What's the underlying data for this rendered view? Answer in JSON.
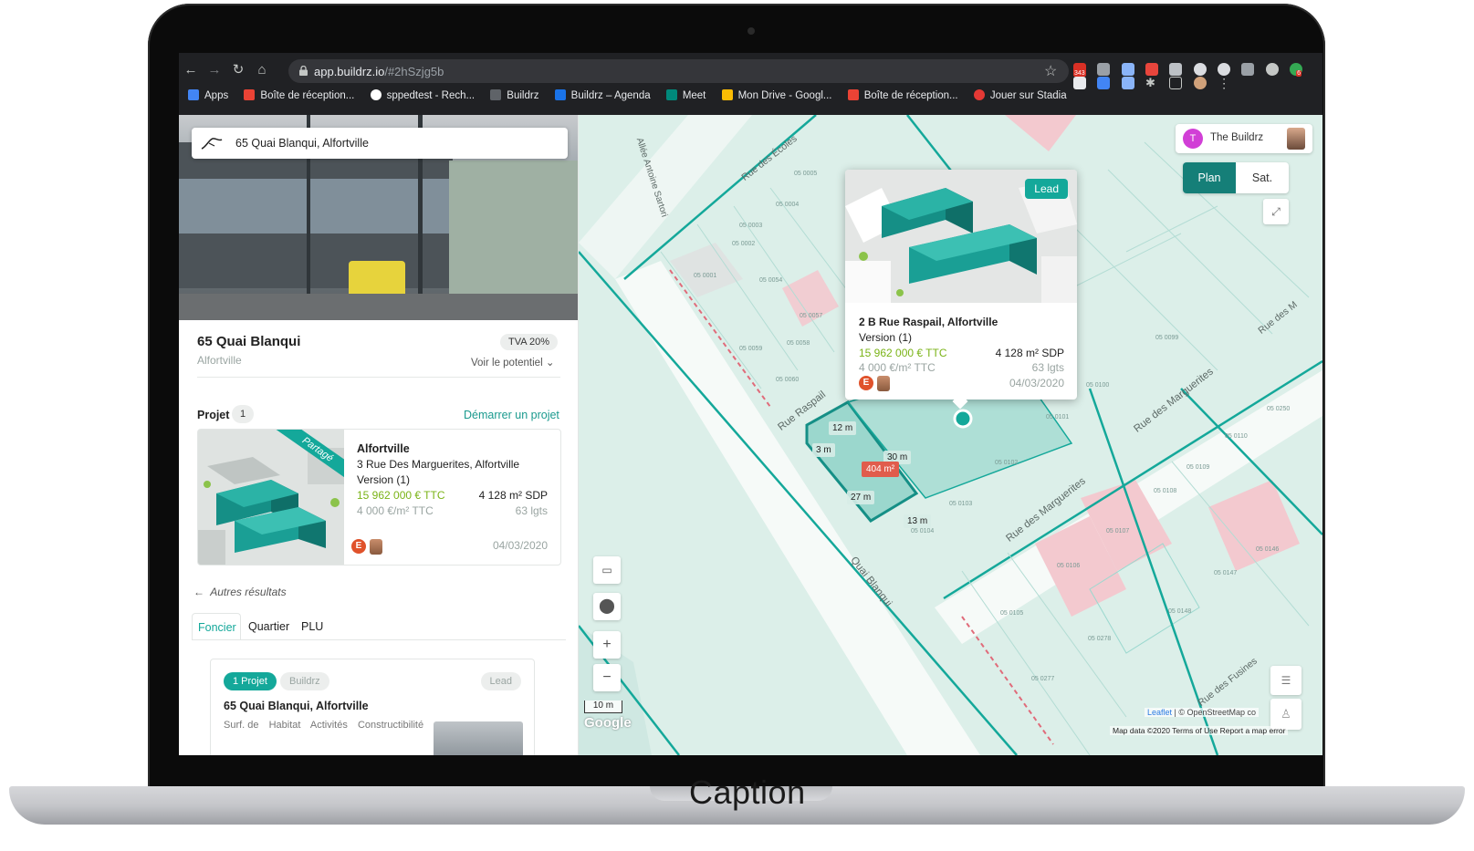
{
  "caption": "Caption",
  "browser": {
    "url_host": "app.buildrz.io",
    "url_path": "/#2hSzjg5b",
    "extension_badges": [
      "343",
      "6"
    ],
    "bookmarks": [
      {
        "label": "Apps",
        "color": "#4285f4"
      },
      {
        "label": "Boîte de réception...",
        "color": "#ea4335"
      },
      {
        "label": "sppedtest - Rech...",
        "color": "#34a853"
      },
      {
        "label": "Buildrz",
        "color": "#333333"
      },
      {
        "label": "Buildrz – Agenda",
        "color": "#1a73e8"
      },
      {
        "label": "Meet",
        "color": "#00897b"
      },
      {
        "label": "Mon Drive - Googl...",
        "color": "#fbbc04"
      },
      {
        "label": "Boîte de réception...",
        "color": "#ea4335"
      },
      {
        "label": "Jouer sur Stadia",
        "color": "#e53935"
      }
    ]
  },
  "left_panel": {
    "search_value": "65 Quai Blanqui, Alfortville",
    "address_title": "65 Quai Blanqui",
    "address_city": "Alfortville",
    "tva_badge": "TVA 20%",
    "potential_link": "Voir le potentiel",
    "projet_label": "Projet",
    "projet_count": "1",
    "start_project": "Démarrer un projet",
    "project_card": {
      "ribbon": "Partagé",
      "title": "Alfortville",
      "address": "3 Rue Des Marguerites, Alfortville",
      "version": "Version (1)",
      "price": "15 962 000 € TTC",
      "sdp": "4 128 m² SDP",
      "unit_price": "4 000 €/m² TTC",
      "lots": "63 lgts",
      "avatar_initial": "E",
      "date": "04/03/2020"
    },
    "other_results": "Autres résultats",
    "tabs": [
      "Foncier",
      "Quartier",
      "PLU"
    ],
    "sub_card": {
      "badge_projects": "1 Projet",
      "badge_buildrz": "Buildrz",
      "badge_lead": "Lead",
      "title": "65 Quai Blanqui, Alfortville",
      "columns": [
        "Surf. de",
        "Habitat",
        "Activités",
        "Constructibilité"
      ]
    }
  },
  "map": {
    "user_initial": "T",
    "user_name": "The Buildrz",
    "view_plan": "Plan",
    "view_sat": "Sat.",
    "popup": {
      "badge": "Lead",
      "address": "2 B Rue Raspail, Alfortville",
      "version": "Version (1)",
      "price": "15 962 000 € TTC",
      "sdp": "4 128 m² SDP",
      "unit_price": "4 000 €/m² TTC",
      "lots": "63 lgts",
      "avatar_initial": "E",
      "date": "04/03/2020"
    },
    "dimensions": [
      "12 m",
      "3 m",
      "30 m",
      "27 m",
      "13 m"
    ],
    "area": "404 m²",
    "streets": [
      "Rue Raspail",
      "Quai Blanqui",
      "Rue des Marguerites",
      "Rue des Marguerites",
      "Allée Antoine Sartori",
      "Rue des Écoles",
      "Rue des Fusines",
      "Rue des M"
    ],
    "parcels": [
      "05 0001",
      "05 0002",
      "05 0003",
      "05 0004",
      "05 0005",
      "05 0054",
      "05 0057",
      "05 0058",
      "05 0059",
      "05 0060",
      "05 0099",
      "05 0100",
      "05 0101",
      "05 0102",
      "05 0103",
      "05 0104",
      "05 0105",
      "05 0106",
      "05 0107",
      "05 0108",
      "05 0109",
      "05 0110",
      "05 0146",
      "05 0147",
      "05 0148",
      "05 0250",
      "05 0277",
      "05 0278"
    ],
    "zoom_in": "+",
    "zoom_out": "−",
    "scale": "10 m",
    "google": "Google",
    "attribution_leaflet": "Leaflet",
    "attribution_osm": "| © OpenStreetMap co",
    "map_data": "Map data ©2020   Terms of Use   Report a map error"
  }
}
